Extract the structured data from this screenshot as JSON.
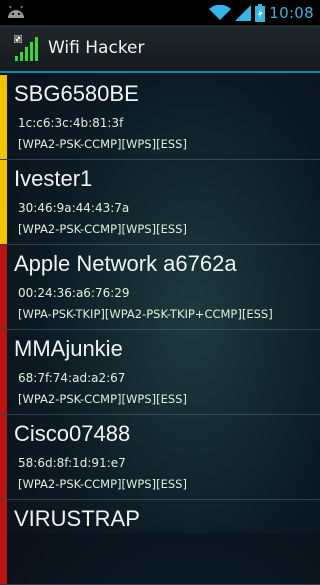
{
  "status_bar": {
    "time": "10:08",
    "icons": [
      "android-icon",
      "wifi-icon",
      "signal-icon",
      "battery-icon"
    ]
  },
  "app": {
    "title": "Wifi Hacker",
    "icon": "wifi-hacker-app-icon"
  },
  "networks": [
    {
      "ssid": "SBG6580BE",
      "bssid": "1c:c6:3c:4b:81:3f",
      "capabilities": "[WPA2-PSK-CCMP][WPS][ESS]",
      "stripe_color": "#f2c400"
    },
    {
      "ssid": "Ivester1",
      "bssid": "30:46:9a:44:43:7a",
      "capabilities": "[WPA2-PSK-CCMP][WPS][ESS]",
      "stripe_color": "#f2c400"
    },
    {
      "ssid": "Apple Network a6762a",
      "bssid": "00:24:36:a6:76:29",
      "capabilities": "[WPA-PSK-TKIP][WPA2-PSK-TKIP+CCMP][ESS]",
      "stripe_color": "#b81414"
    },
    {
      "ssid": "MMAjunkie",
      "bssid": "68:7f:74:ad:a2:67",
      "capabilities": "[WPA2-PSK-CCMP][WPS][ESS]",
      "stripe_color": "#b81414"
    },
    {
      "ssid": "Cisco07488",
      "bssid": "58:6d:8f:1d:91:e7",
      "capabilities": "[WPA2-PSK-CCMP][WPS][ESS]",
      "stripe_color": "#b81414"
    },
    {
      "ssid": "VIRUSTRAP",
      "bssid": "",
      "capabilities": "",
      "stripe_color": "#b81414"
    }
  ]
}
